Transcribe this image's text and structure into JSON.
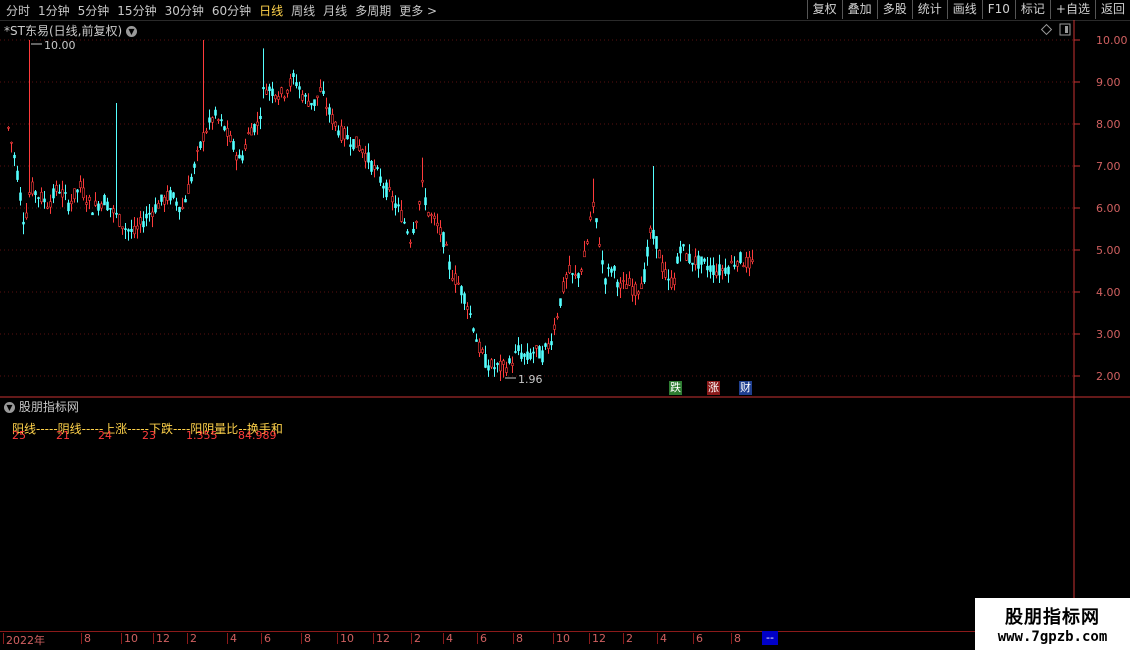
{
  "toolbar": {
    "periods": [
      "分时",
      "1分钟",
      "5分钟",
      "15分钟",
      "30分钟",
      "60分钟",
      "日线",
      "周线",
      "月线",
      "多周期",
      "更多 >"
    ],
    "active_period": "日线",
    "right_tools": [
      "复权",
      "叠加",
      "多股",
      "统计",
      "画线",
      "F10",
      "标记",
      "+自选",
      "返回"
    ]
  },
  "chart": {
    "title": "*ST东易(日线,前复权)",
    "high_label": "10.00",
    "low_label": "1.96",
    "y_ticks": [
      "10.00",
      "9.00",
      "8.00",
      "7.00",
      "6.00",
      "5.00",
      "4.00",
      "3.00",
      "2.00"
    ],
    "badges": [
      "跌",
      "涨",
      "财"
    ],
    "colors": {
      "up": "#ff3b3b",
      "down": "#54ffff",
      "axis": "#c83232",
      "grid": "#5a1010"
    }
  },
  "indicator": {
    "title": "股朋指标网",
    "headers": "阳线-----阴线-----上涨-----下跌----阳阴量比--换手和",
    "values": [
      "25",
      "21",
      "24",
      "23",
      "1.355",
      "84.989"
    ]
  },
  "xaxis": {
    "labels": [
      "2022年",
      "8",
      "10",
      "12",
      "2",
      "4",
      "6",
      "8",
      "10",
      "12",
      "2",
      "4",
      "6",
      "8",
      "10",
      "12",
      "2",
      "4",
      "6",
      "8"
    ],
    "cursor": "--"
  },
  "watermark": {
    "name": "股朋指标网",
    "url": "www.7gpzb.com"
  }
}
